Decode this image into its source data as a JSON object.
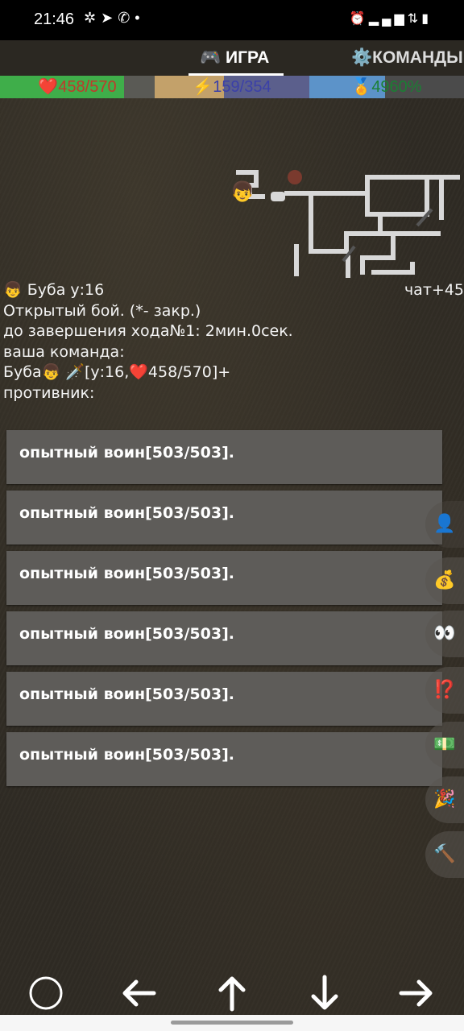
{
  "status_bar": {
    "time": "21:46",
    "left_icons": [
      "bug-icon",
      "telegram-icon",
      "whatsapp-icon",
      "dot-icon"
    ],
    "right_icons": [
      "alarm-icon",
      "signal-icon",
      "signal-h-icon",
      "signal-icon",
      "battery-icon"
    ]
  },
  "tabs": {
    "game": {
      "icon": "🎮",
      "label": "ИГРА",
      "active": true
    },
    "teams": {
      "icon": "⚙️",
      "label": "КОМАНДЫ"
    }
  },
  "bars": {
    "hp": {
      "icon": "❤️",
      "text": "458/570",
      "fill": 0.8,
      "color": "#3fae4a"
    },
    "energy": {
      "icon": "⚡",
      "text": "159/354",
      "fill": 0.45,
      "color": "#c3a16a"
    },
    "xp": {
      "icon": "🏅",
      "text": "4960%",
      "fill": 0.49,
      "color": "#5c93c9"
    }
  },
  "player": {
    "line": "👦 Буба  у:16",
    "chat": "чат+45"
  },
  "battle": {
    "type": "Открытый бой. (*- закр.)",
    "timer": "до завершения хода№1: 2мин.0сек.",
    "team_label": "ваша команда:",
    "team_member": " Буба👦 🗡️[у:16,❤️458/570]+",
    "enemy_label": "противник:"
  },
  "enemies": [
    "опытный воин[503/503].",
    "опытный воин[503/503].",
    "опытный воин[503/503].",
    "опытный воин[503/503].",
    "опытный воин[503/503].",
    "опытный воин[503/503]."
  ],
  "side_buttons": [
    {
      "icon": "👤",
      "name": "profile-side-icon"
    },
    {
      "icon": "💰",
      "name": "money-bag-icon"
    },
    {
      "icon": "👀",
      "name": "eyes-icon"
    },
    {
      "icon": "⁉️",
      "name": "interrobang-icon"
    },
    {
      "icon": "💵",
      "name": "cash-icon"
    },
    {
      "icon": "🎉",
      "name": "party-icon"
    },
    {
      "icon": "🔨",
      "name": "hammer-icon"
    }
  ],
  "nav": [
    "circle-icon",
    "arrow-left-icon",
    "arrow-up-icon",
    "arrow-down-icon",
    "arrow-right-icon"
  ]
}
